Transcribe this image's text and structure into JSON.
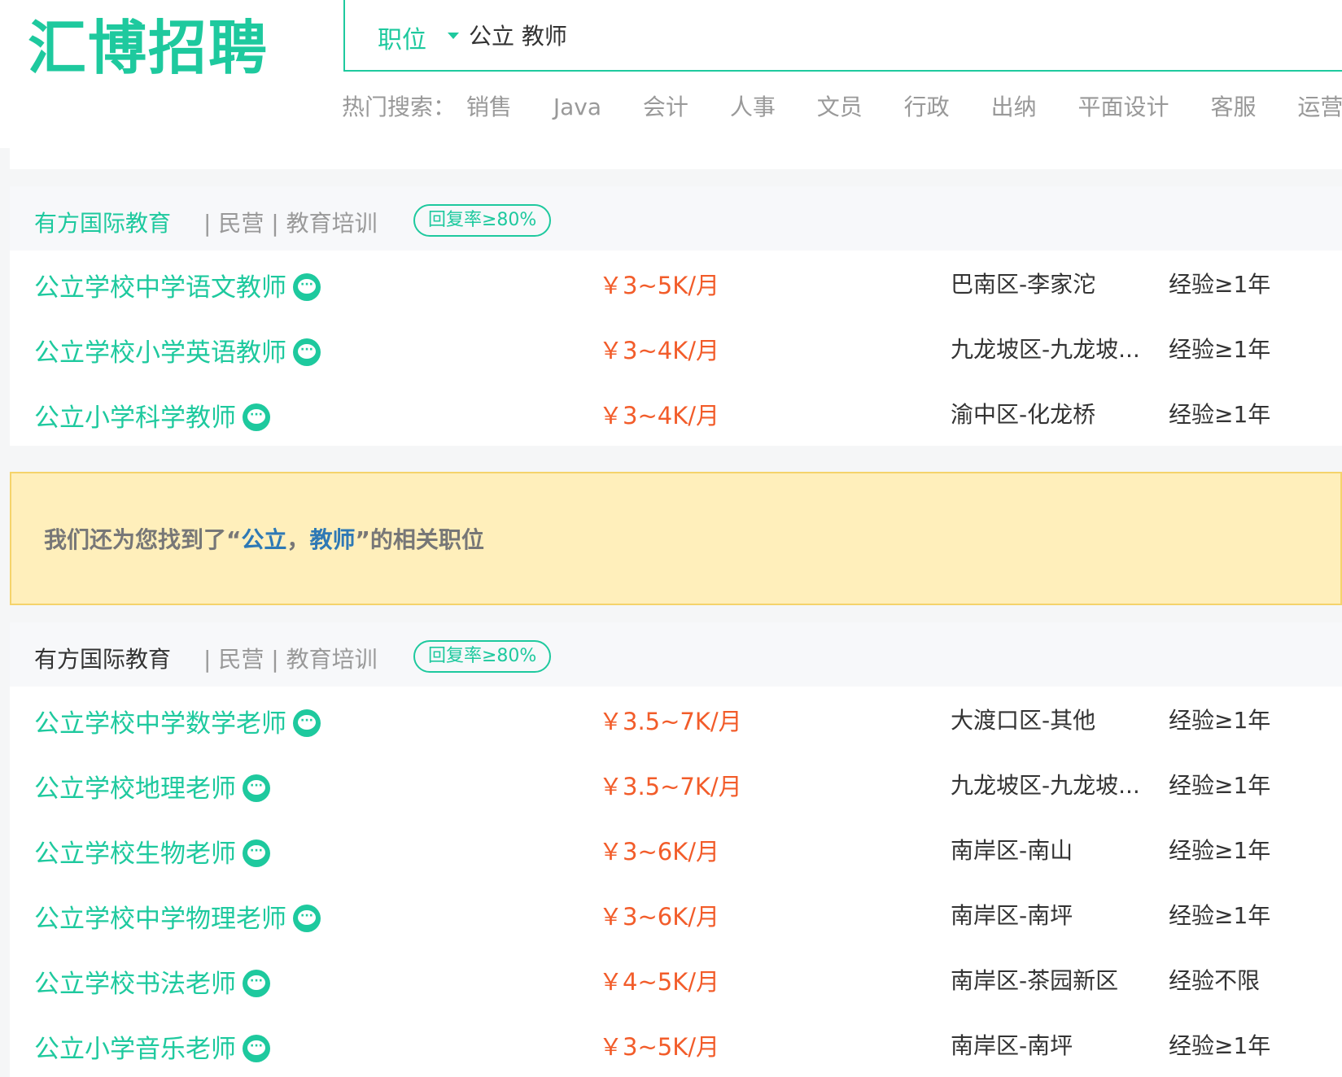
{
  "header": {
    "logo": "汇博招聘",
    "search": {
      "type_label": "职位",
      "query": "公立 教师"
    },
    "hot_search": {
      "label": "热门搜索：",
      "items": [
        "销售",
        "Java",
        "会计",
        "人事",
        "文员",
        "行政",
        "出纳",
        "平面设计",
        "客服",
        "运营"
      ]
    }
  },
  "sections": [
    {
      "company": "有方国际教育",
      "meta": "| 民营 | 教育培训",
      "badge": "回复率≥80%",
      "jobs": [
        {
          "title": "公立学校中学语文教师",
          "salary": "￥3~5K/月",
          "location": "巴南区-李家沱",
          "exp": "经验≥1年"
        },
        {
          "title": "公立学校小学英语教师",
          "salary": "￥3~4K/月",
          "location": "九龙坡区-九龙坡...",
          "exp": "经验≥1年"
        },
        {
          "title": "公立小学科学教师",
          "salary": "￥3~4K/月",
          "location": "渝中区-化龙桥",
          "exp": "经验≥1年"
        }
      ]
    },
    {
      "company": "有方国际教育",
      "meta": "| 民营 | 教育培训",
      "badge": "回复率≥80%",
      "jobs": [
        {
          "title": "公立学校中学数学老师",
          "salary": "￥3.5~7K/月",
          "location": "大渡口区-其他",
          "exp": "经验≥1年"
        },
        {
          "title": "公立学校地理老师",
          "salary": "￥3.5~7K/月",
          "location": "九龙坡区-九龙坡...",
          "exp": "经验≥1年"
        },
        {
          "title": "公立学校生物老师",
          "salary": "￥3~6K/月",
          "location": "南岸区-南山",
          "exp": "经验≥1年"
        },
        {
          "title": "公立学校中学物理老师",
          "salary": "￥3~6K/月",
          "location": "南岸区-南坪",
          "exp": "经验≥1年"
        },
        {
          "title": "公立学校书法老师",
          "salary": "￥4~5K/月",
          "location": "南岸区-茶园新区",
          "exp": "经验不限"
        },
        {
          "title": "公立小学音乐老师",
          "salary": "￥3~5K/月",
          "location": "南岸区-南坪",
          "exp": "经验≥1年"
        }
      ]
    }
  ],
  "notice": {
    "prefix": "我们还为您找到了“",
    "kw1": "公立",
    "sep": "，",
    "kw2": "教师",
    "suffix": "”的相关职位"
  },
  "colors": {
    "brand": "#1ec99e",
    "salary": "#f25c2a",
    "keyword": "#2e79b5",
    "notice_bg": "#ffefbb"
  }
}
